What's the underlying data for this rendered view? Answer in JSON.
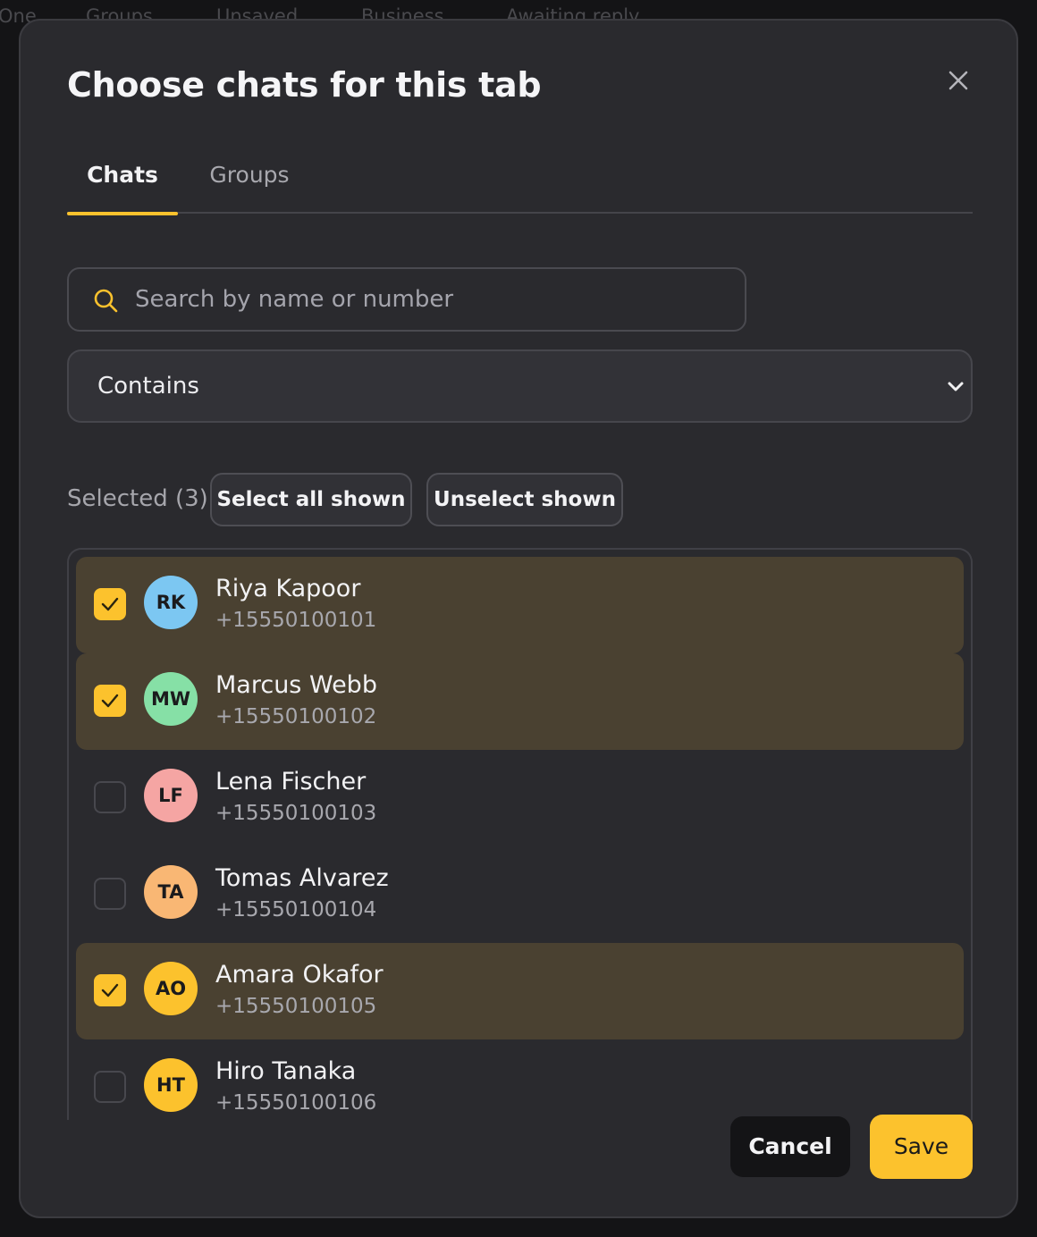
{
  "background": {
    "tabs": [
      "One",
      "Groups",
      "Unsaved",
      "Business",
      "Awaiting reply"
    ]
  },
  "modal": {
    "title": "Choose chats for this tab",
    "close_icon": "close-icon",
    "tabs": [
      {
        "label": "Chats",
        "active": true
      },
      {
        "label": "Groups",
        "active": false
      }
    ],
    "search": {
      "placeholder": "Search by name or number",
      "value": "",
      "icon": "search-icon"
    },
    "match_mode": {
      "selected": "Contains",
      "icon": "chevron-down-icon"
    },
    "selected_label": "Selected (3)",
    "select_all_label": "Select all shown",
    "unselect_label": "Unselect shown",
    "contacts": [
      {
        "initials": "RK",
        "name": "Riya Kapoor",
        "phone": "+15550100101",
        "checked": true,
        "color": "#7cc7f2"
      },
      {
        "initials": "MW",
        "name": "Marcus Webb",
        "phone": "+15550100102",
        "checked": true,
        "color": "#86e0a6"
      },
      {
        "initials": "LF",
        "name": "Lena Fischer",
        "phone": "+15550100103",
        "checked": false,
        "color": "#f5a5a3"
      },
      {
        "initials": "TA",
        "name": "Tomas Alvarez",
        "phone": "+15550100104",
        "checked": false,
        "color": "#f9b774"
      },
      {
        "initials": "AO",
        "name": "Amara Okafor",
        "phone": "+15550100105",
        "checked": true,
        "color": "#fcc22d"
      },
      {
        "initials": "HT",
        "name": "Hiro Tanaka",
        "phone": "+15550100106",
        "checked": false,
        "color": "#fcc22d"
      }
    ],
    "cancel_label": "Cancel",
    "save_label": "Save",
    "accent_color": "#fcc22d"
  }
}
